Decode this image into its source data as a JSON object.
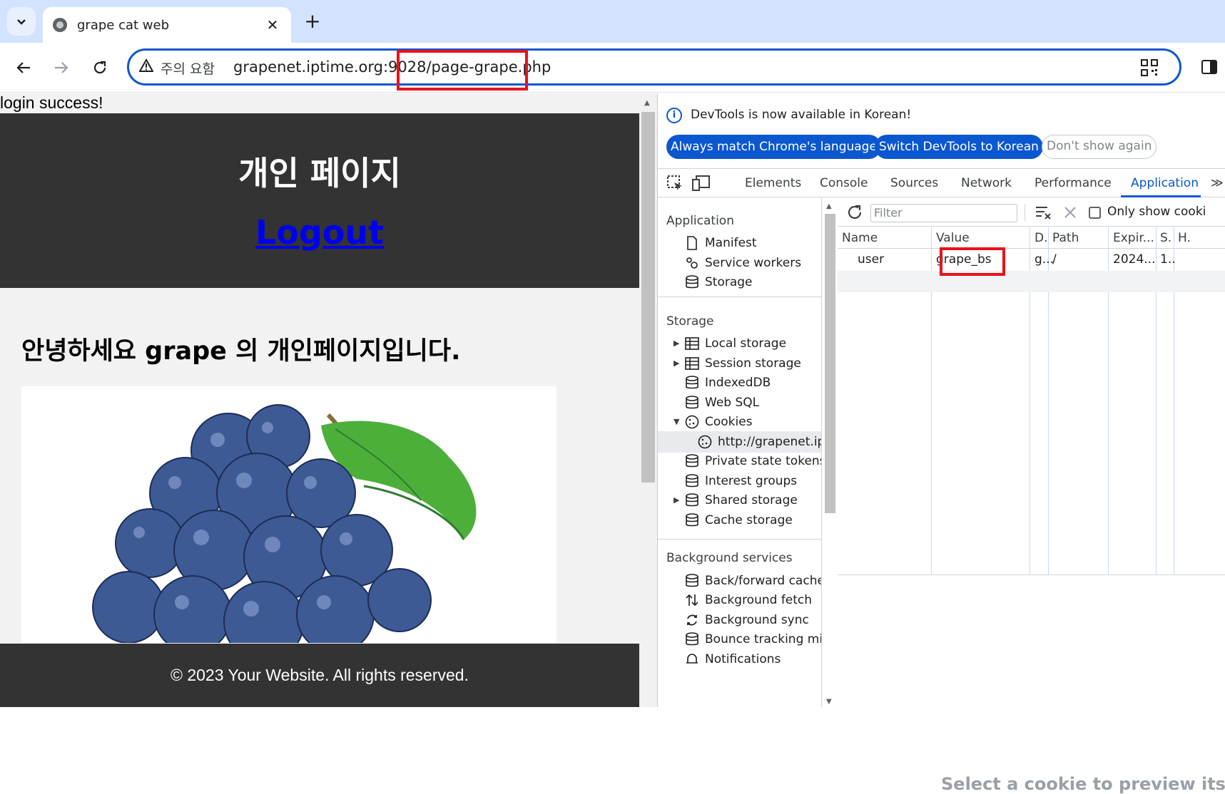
{
  "browser": {
    "tab_title": "grape cat web",
    "tab_close": "✕",
    "new_tab": "+",
    "omnibox": {
      "security_label": "주의 요함",
      "url_host": "grapenet.iptime.org:9028",
      "url_path": "/page-grape.php"
    },
    "icons": {
      "tab_search": "chevron-down-icon",
      "back": "back-arrow-icon",
      "forward": "forward-arrow-icon",
      "reload": "reload-icon",
      "warning": "warning-icon",
      "qr": "qr-code-icon",
      "side_panel": "side-panel-icon"
    }
  },
  "page": {
    "login_message": "login success!",
    "header_title": "개인 페이지",
    "logout_link": "Logout",
    "greeting": "안녕하세요 grape 의 개인페이지입니다.",
    "footer": "© 2023 Your Website. All rights reserved."
  },
  "devtools": {
    "infobar": {
      "message": "DevTools is now available in Korean!",
      "btn_match": "Always match Chrome's language",
      "btn_switch": "Switch DevTools to Korean",
      "btn_dismiss": "Don't show again"
    },
    "tabs": [
      "Elements",
      "Console",
      "Sources",
      "Network",
      "Performance",
      "Application"
    ],
    "active_tab": "Application",
    "more_tabs": "≫",
    "sidebar": {
      "application_heading": "Application",
      "application_items": [
        "Manifest",
        "Service workers",
        "Storage"
      ],
      "storage_heading": "Storage",
      "storage_items": [
        "Local storage",
        "Session storage",
        "IndexedDB",
        "Web SQL",
        "Cookies",
        "http://grapenet.ip",
        "Private state tokens",
        "Interest groups",
        "Shared storage",
        "Cache storage"
      ],
      "background_heading": "Background services",
      "background_items": [
        "Back/forward cache",
        "Background fetch",
        "Background sync",
        "Bounce tracking mit",
        "Notifications"
      ]
    },
    "cookies": {
      "filter_placeholder": "Filter",
      "only_show_label": "Only show cooki",
      "columns": [
        "Name",
        "Value",
        "D.",
        "Path",
        "Expir...",
        "S.",
        "H."
      ],
      "rows": [
        [
          "user",
          "grape_bs",
          "g...",
          "/",
          "2024...",
          "1..",
          ""
        ]
      ],
      "preview_message": "Select a cookie to preview its v"
    }
  },
  "colors": {
    "accent": "#0b57d0",
    "highlight_box": "#e8121c",
    "page_header_bg": "#333333"
  }
}
